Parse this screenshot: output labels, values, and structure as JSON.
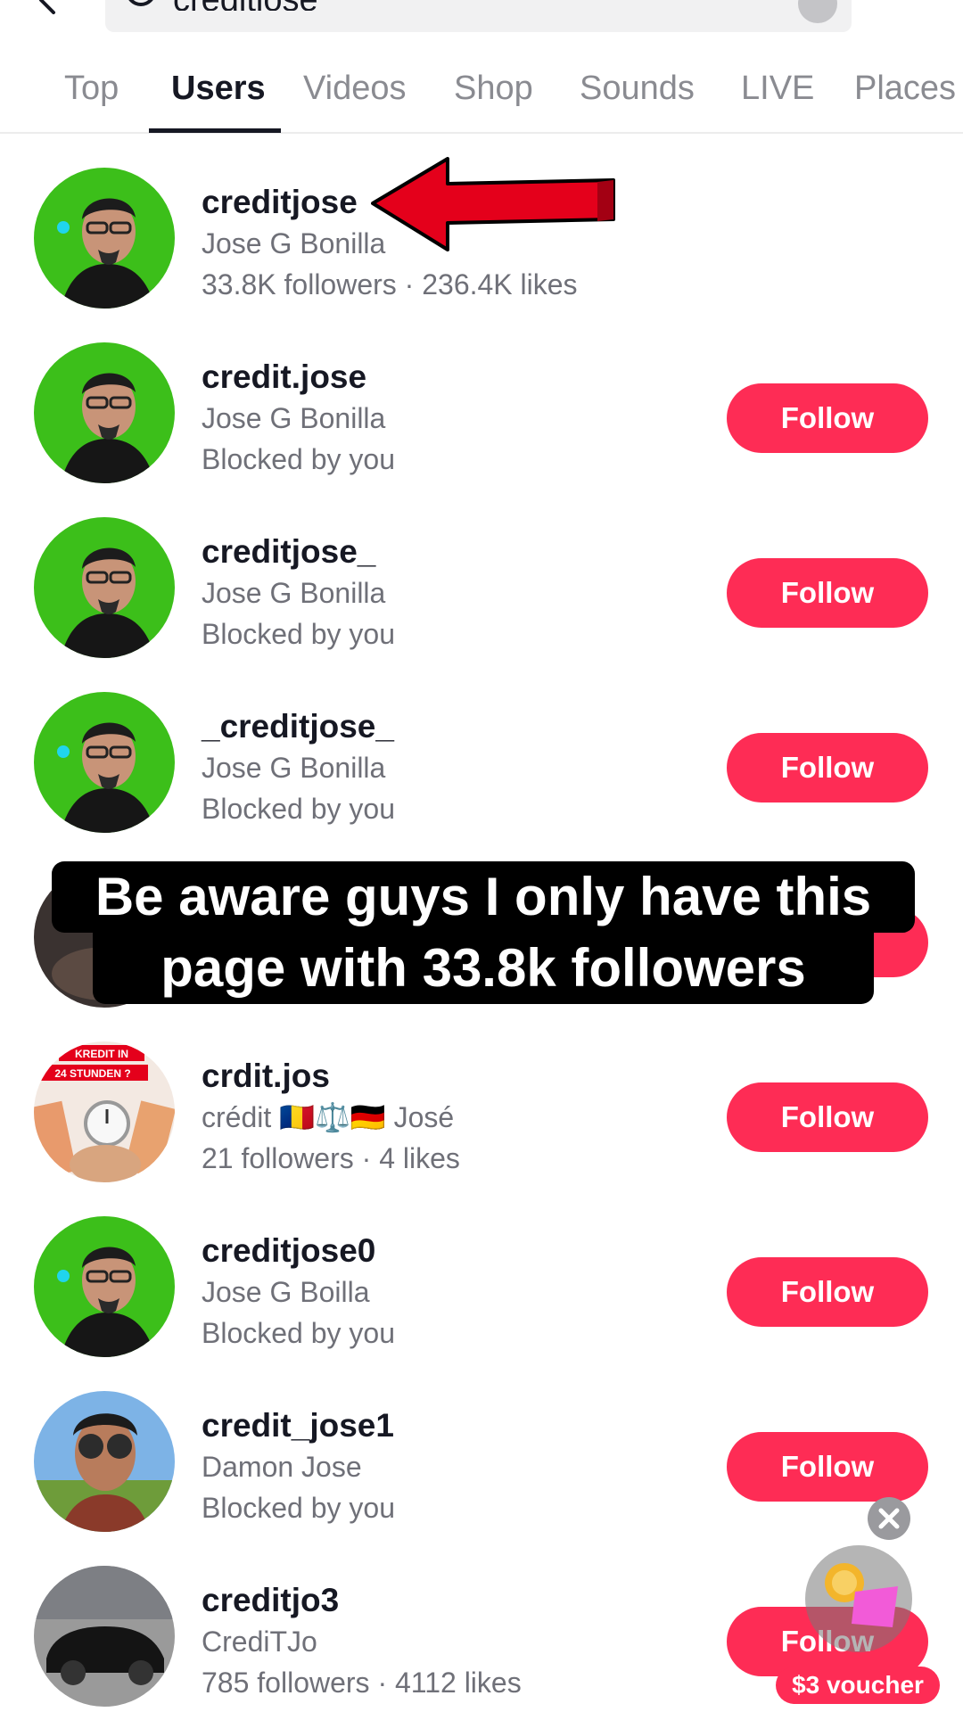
{
  "search": {
    "query": "creditjose"
  },
  "tabs": [
    {
      "label": "Top",
      "active": false
    },
    {
      "label": "Users",
      "active": true
    },
    {
      "label": "Videos",
      "active": false
    },
    {
      "label": "Shop",
      "active": false
    },
    {
      "label": "Sounds",
      "active": false
    },
    {
      "label": "LIVE",
      "active": false
    },
    {
      "label": "Places",
      "active": false
    }
  ],
  "users": [
    {
      "username": "creditjose",
      "nickname": "Jose G Bonilla",
      "subline": "33.8K followers · 236.4K likes",
      "follow_label": "",
      "avatar": "green-portrait-verified"
    },
    {
      "username": "credit.jose",
      "nickname": "Jose G Bonilla",
      "subline": "Blocked by you",
      "follow_label": "Follow",
      "avatar": "green-portrait"
    },
    {
      "username": "creditjose_",
      "nickname": "Jose G Bonilla",
      "subline": "Blocked by you",
      "follow_label": "Follow",
      "avatar": "green-portrait"
    },
    {
      "username": "_creditjose_",
      "nickname": "Jose G Bonilla",
      "subline": "Blocked by you",
      "follow_label": "Follow",
      "avatar": "green-portrait-verified"
    },
    {
      "username": "",
      "nickname": "",
      "subline": "",
      "follow_label": "",
      "avatar": "dark-partial"
    },
    {
      "username": "crdit.jos",
      "nickname": "crédit 🇷🇴⚖️🇩🇪 José",
      "subline": "21 followers · 4 likes",
      "follow_label": "Follow",
      "avatar": "money-stopwatch",
      "avatar_text": [
        "KREDIT IN",
        "24 STUNDEN ?"
      ]
    },
    {
      "username": "creditjose0",
      "nickname": "Jose G Boilla",
      "subline": "Blocked by you",
      "follow_label": "Follow",
      "avatar": "green-portrait-verified"
    },
    {
      "username": "credit_jose1",
      "nickname": "Damon Jose",
      "subline": "Blocked by you",
      "follow_label": "Follow",
      "avatar": "sunglasses-selfie"
    },
    {
      "username": "creditjo3",
      "nickname": "CrediTJo",
      "subline": "785 followers · 4112 likes",
      "follow_label": "Follow",
      "avatar": "black-car"
    }
  ],
  "caption": {
    "line1": "Be aware guys I only have this",
    "line2": "page with 33.8k followers"
  },
  "voucher": {
    "label": "$3 voucher"
  },
  "colors": {
    "accent": "#fe2c55",
    "avatar_green": "#3cbf1a",
    "verified_blue": "#20d5ec",
    "arrow_red": "#e4001b"
  }
}
